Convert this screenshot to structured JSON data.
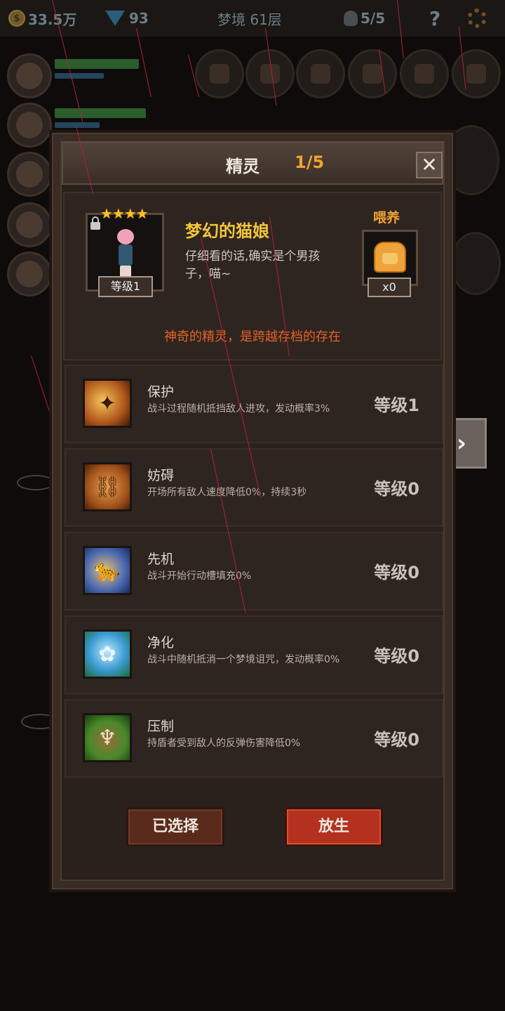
{
  "topbar": {
    "gold": "33.5万",
    "gold_icon": "coin-icon",
    "gems": "93",
    "floor": "梦境 61层",
    "skulls": "5/5",
    "help": "?"
  },
  "dialog": {
    "title": "精灵",
    "count": "1/5",
    "close_symbol": "✕"
  },
  "pet": {
    "stars": "★★★★",
    "level": "等级1",
    "name": "梦幻的猫娘",
    "description": "仔细看的话,确实是个男孩子，喵~",
    "feed_label": "喂养",
    "food_count": "x0",
    "tagline": "神奇的精灵，是跨越存档的存在",
    "colors": {
      "name": "#f2c53a",
      "tagline": "#e2622a",
      "feed": "#f0a232"
    }
  },
  "skills": [
    {
      "name": "保护",
      "description": "战斗过程随机抵挡敌人进攻，发动概率3%",
      "level": "等级1",
      "icon": "shield-fairy-icon"
    },
    {
      "name": "妨碍",
      "description": "开场所有敌人速度降低0%，持续3秒",
      "level": "等级0",
      "icon": "chained-boot-icon"
    },
    {
      "name": "先机",
      "description": "战斗开始行动槽填充0%",
      "level": "等级0",
      "icon": "leopard-icon"
    },
    {
      "name": "净化",
      "description": "战斗中随机抵消一个梦境诅咒，发动概率0%",
      "level": "等级0",
      "icon": "blue-flower-icon"
    },
    {
      "name": "压制",
      "description": "持盾者受到敌人的反弹伤害降低0%",
      "level": "等级0",
      "icon": "beast-claw-icon"
    }
  ],
  "buttons": {
    "selected": "已选择",
    "release": "放生"
  },
  "next_arrow": "›"
}
